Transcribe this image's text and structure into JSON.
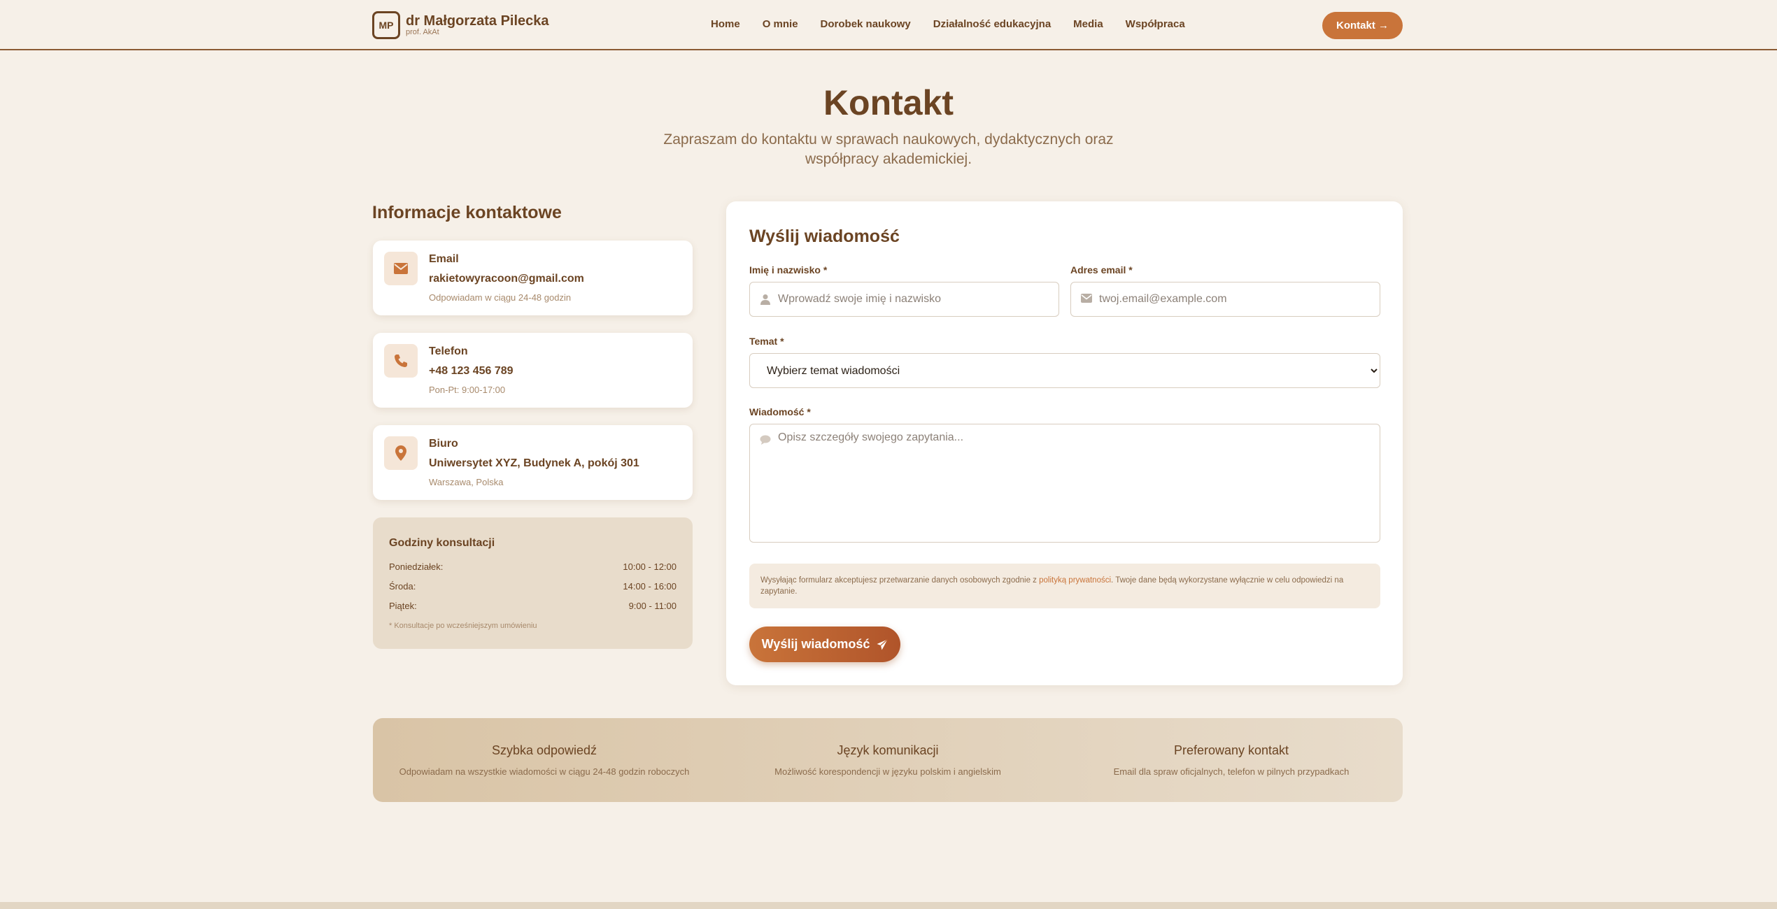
{
  "header": {
    "logo_initials": "MP",
    "name": "dr Małgorzata Pilecka",
    "subtitle": "prof. AkAt",
    "nav": [
      "Home",
      "O mnie",
      "Dorobek naukowy",
      "Działalność edukacyjna",
      "Media",
      "Współpraca"
    ],
    "cta": "Kontakt →"
  },
  "hero": {
    "title": "Kontakt",
    "subtitle": "Zapraszam do kontaktu w sprawach naukowych, dydaktycznych oraz współpracy akademickiej."
  },
  "info": {
    "title": "Informacje kontaktowe",
    "cards": [
      {
        "icon": "envelope-icon",
        "label": "Email",
        "value": "rakietowyracoon@gmail.com",
        "note": "Odpowiadam w ciągu 24-48 godzin"
      },
      {
        "icon": "phone-icon",
        "label": "Telefon",
        "value": "+48 123 456 789",
        "note": "Pon-Pt: 9:00-17:00"
      },
      {
        "icon": "map-pin-icon",
        "label": "Biuro",
        "value": "Uniwersytet XYZ, Budynek A, pokój 301",
        "note": "Warszawa, Polska"
      }
    ],
    "hours": {
      "title": "Godziny konsultacji",
      "rows": [
        {
          "day": "Poniedziałek:",
          "time": "10:00 - 12:00"
        },
        {
          "day": "Środa:",
          "time": "14:00 - 16:00"
        },
        {
          "day": "Piątek:",
          "time": "9:00 - 11:00"
        }
      ],
      "note": "* Konsultacje po wcześniejszym umówieniu"
    }
  },
  "form": {
    "title": "Wyślij wiadomość",
    "name_label": "Imię i nazwisko *",
    "name_placeholder": "Wprowadź swoje imię i nazwisko",
    "email_label": "Adres email *",
    "email_placeholder": "twoj.email@example.com",
    "topic_label": "Temat *",
    "topic_selected": "Wybierz temat wiadomości",
    "message_label": "Wiadomość *",
    "message_placeholder": "Opisz szczegóły swojego zapytania...",
    "consent_before": "Wysyłając formularz akceptujesz przetwarzanie danych osobowych zgodnie z ",
    "consent_link": "polityką prywatności",
    "consent_after": ". Twoje dane będą wykorzystane wyłącznie w celu odpowiedzi na zapytanie.",
    "submit": "Wyślij wiadomość"
  },
  "band": [
    {
      "title": "Szybka odpowiedź",
      "text": "Odpowiadam na wszystkie wiadomości w ciągu 24-48 godzin roboczych"
    },
    {
      "title": "Język komunikacji",
      "text": "Możliwość korespondencji w języku polskim i angielskim"
    },
    {
      "title": "Preferowany kontakt",
      "text": "Email dla spraw oficjalnych, telefon w pilnych przypadkach"
    }
  ],
  "colors": {
    "accent": "#c9743a",
    "brown": "#6b4423",
    "background": "#f6f0e8"
  }
}
